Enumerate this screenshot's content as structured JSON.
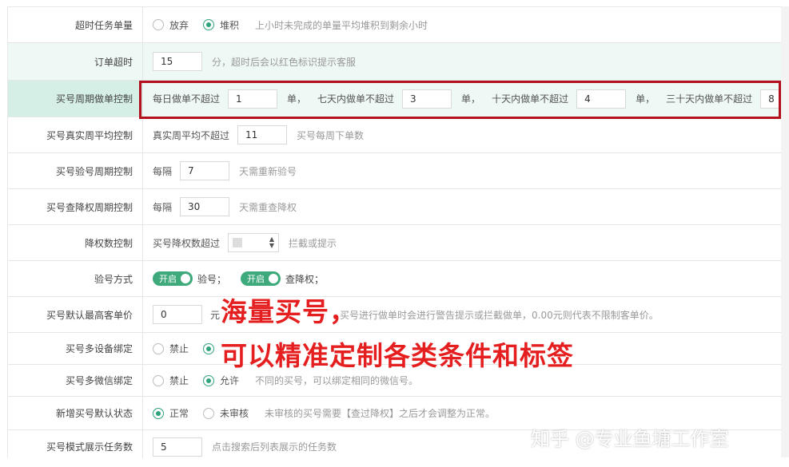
{
  "rows": [
    {
      "label": "超时任务单量",
      "opt1": "放弃",
      "opt2": "堆积",
      "hint": "上小时未完成的单量平均堆积到剩余小时"
    },
    {
      "label": "订单超时",
      "value": "15",
      "hint": "分，超时后会以红色标识提示客服"
    },
    {
      "label": "买号周期做单控制",
      "t1": "每日做单不超过",
      "v1": "1",
      "u1": "单，",
      "t2": "七天内做单不超过",
      "v2": "3",
      "u2": "单，",
      "t3": "十天内做单不超过",
      "v3": "4",
      "u3": "单，",
      "t4": "三十天内做单不超过",
      "v4": "8"
    },
    {
      "label": "买号真实周平均控制",
      "pre": "真实周平均不超过",
      "value": "11",
      "hint": "买号每周下单数"
    },
    {
      "label": "买号验号周期控制",
      "pre": "每隔",
      "value": "7",
      "hint": "天需重新验号"
    },
    {
      "label": "买号查降权周期控制",
      "pre": "每隔",
      "value": "30",
      "hint": "天需重查降权"
    },
    {
      "label": "降权数控制",
      "pre": "买号降权数超过",
      "hint": "拦截或提示"
    },
    {
      "label": "验号方式",
      "toggle1": "开启",
      "text1": "验号；",
      "toggle2": "开启",
      "text2": "查降权；"
    },
    {
      "label": "买号默认最高客单价",
      "value": "0",
      "pre_hint": "元",
      "hint": "买号进行做单时会进行警告提示或拦截做单，0.00元则代表不限制客单价。"
    },
    {
      "label": "买号多设备绑定",
      "opt1": "禁止"
    },
    {
      "label": "买号多微信绑定",
      "opt1": "禁止",
      "opt2": "允许",
      "hint": "不同的买号，可以绑定相同的微信号。"
    },
    {
      "label": "新增买号默认状态",
      "opt1": "正常",
      "opt2": "未审核",
      "hint": "未审核的买号需要【查过降权】之后才会调整为正常。"
    },
    {
      "label": "买号模式展示任务数",
      "value": "5",
      "hint": "点击搜索后列表展示的任务数"
    }
  ],
  "overlay": {
    "line1": "海量买号，",
    "line2": "可以精准定制各类条件和标签",
    "color": "#e51f1f"
  },
  "watermark": "知乎 @专业鱼塘工作室",
  "colors": {
    "accent": "#2fa37a",
    "highlight_border": "#b3121d"
  }
}
